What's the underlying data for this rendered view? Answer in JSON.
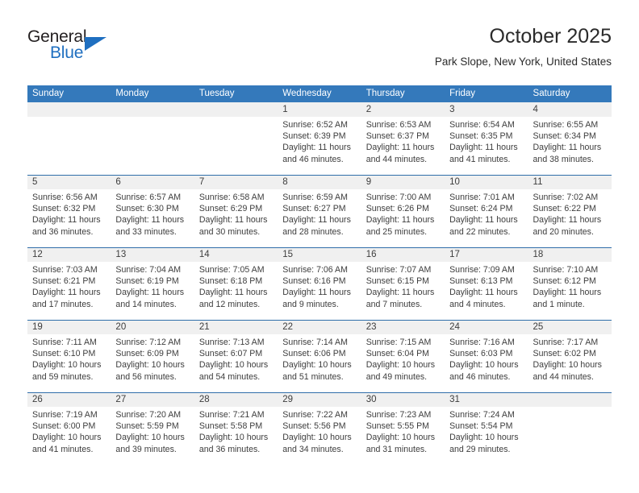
{
  "brand": {
    "word1": "General",
    "word2": "Blue",
    "accent_color": "#1f6fc0"
  },
  "header": {
    "title": "October 2025",
    "subtitle": "Park Slope, New York, United States"
  },
  "theme": {
    "header_bg": "#3479bb",
    "daynum_bg": "#f0f0f0",
    "rule_color": "#2f6ea9",
    "text_color": "#3d3d3d"
  },
  "weekday_headers": [
    "Sunday",
    "Monday",
    "Tuesday",
    "Wednesday",
    "Thursday",
    "Friday",
    "Saturday"
  ],
  "weeks": [
    [
      {
        "day": "",
        "sunrise": "",
        "sunset": "",
        "daylight": "",
        "daylight2": ""
      },
      {
        "day": "",
        "sunrise": "",
        "sunset": "",
        "daylight": "",
        "daylight2": ""
      },
      {
        "day": "",
        "sunrise": "",
        "sunset": "",
        "daylight": "",
        "daylight2": ""
      },
      {
        "day": "1",
        "sunrise": "Sunrise: 6:52 AM",
        "sunset": "Sunset: 6:39 PM",
        "daylight": "Daylight: 11 hours",
        "daylight2": "and 46 minutes."
      },
      {
        "day": "2",
        "sunrise": "Sunrise: 6:53 AM",
        "sunset": "Sunset: 6:37 PM",
        "daylight": "Daylight: 11 hours",
        "daylight2": "and 44 minutes."
      },
      {
        "day": "3",
        "sunrise": "Sunrise: 6:54 AM",
        "sunset": "Sunset: 6:35 PM",
        "daylight": "Daylight: 11 hours",
        "daylight2": "and 41 minutes."
      },
      {
        "day": "4",
        "sunrise": "Sunrise: 6:55 AM",
        "sunset": "Sunset: 6:34 PM",
        "daylight": "Daylight: 11 hours",
        "daylight2": "and 38 minutes."
      }
    ],
    [
      {
        "day": "5",
        "sunrise": "Sunrise: 6:56 AM",
        "sunset": "Sunset: 6:32 PM",
        "daylight": "Daylight: 11 hours",
        "daylight2": "and 36 minutes."
      },
      {
        "day": "6",
        "sunrise": "Sunrise: 6:57 AM",
        "sunset": "Sunset: 6:30 PM",
        "daylight": "Daylight: 11 hours",
        "daylight2": "and 33 minutes."
      },
      {
        "day": "7",
        "sunrise": "Sunrise: 6:58 AM",
        "sunset": "Sunset: 6:29 PM",
        "daylight": "Daylight: 11 hours",
        "daylight2": "and 30 minutes."
      },
      {
        "day": "8",
        "sunrise": "Sunrise: 6:59 AM",
        "sunset": "Sunset: 6:27 PM",
        "daylight": "Daylight: 11 hours",
        "daylight2": "and 28 minutes."
      },
      {
        "day": "9",
        "sunrise": "Sunrise: 7:00 AM",
        "sunset": "Sunset: 6:26 PM",
        "daylight": "Daylight: 11 hours",
        "daylight2": "and 25 minutes."
      },
      {
        "day": "10",
        "sunrise": "Sunrise: 7:01 AM",
        "sunset": "Sunset: 6:24 PM",
        "daylight": "Daylight: 11 hours",
        "daylight2": "and 22 minutes."
      },
      {
        "day": "11",
        "sunrise": "Sunrise: 7:02 AM",
        "sunset": "Sunset: 6:22 PM",
        "daylight": "Daylight: 11 hours",
        "daylight2": "and 20 minutes."
      }
    ],
    [
      {
        "day": "12",
        "sunrise": "Sunrise: 7:03 AM",
        "sunset": "Sunset: 6:21 PM",
        "daylight": "Daylight: 11 hours",
        "daylight2": "and 17 minutes."
      },
      {
        "day": "13",
        "sunrise": "Sunrise: 7:04 AM",
        "sunset": "Sunset: 6:19 PM",
        "daylight": "Daylight: 11 hours",
        "daylight2": "and 14 minutes."
      },
      {
        "day": "14",
        "sunrise": "Sunrise: 7:05 AM",
        "sunset": "Sunset: 6:18 PM",
        "daylight": "Daylight: 11 hours",
        "daylight2": "and 12 minutes."
      },
      {
        "day": "15",
        "sunrise": "Sunrise: 7:06 AM",
        "sunset": "Sunset: 6:16 PM",
        "daylight": "Daylight: 11 hours",
        "daylight2": "and 9 minutes."
      },
      {
        "day": "16",
        "sunrise": "Sunrise: 7:07 AM",
        "sunset": "Sunset: 6:15 PM",
        "daylight": "Daylight: 11 hours",
        "daylight2": "and 7 minutes."
      },
      {
        "day": "17",
        "sunrise": "Sunrise: 7:09 AM",
        "sunset": "Sunset: 6:13 PM",
        "daylight": "Daylight: 11 hours",
        "daylight2": "and 4 minutes."
      },
      {
        "day": "18",
        "sunrise": "Sunrise: 7:10 AM",
        "sunset": "Sunset: 6:12 PM",
        "daylight": "Daylight: 11 hours",
        "daylight2": "and 1 minute."
      }
    ],
    [
      {
        "day": "19",
        "sunrise": "Sunrise: 7:11 AM",
        "sunset": "Sunset: 6:10 PM",
        "daylight": "Daylight: 10 hours",
        "daylight2": "and 59 minutes."
      },
      {
        "day": "20",
        "sunrise": "Sunrise: 7:12 AM",
        "sunset": "Sunset: 6:09 PM",
        "daylight": "Daylight: 10 hours",
        "daylight2": "and 56 minutes."
      },
      {
        "day": "21",
        "sunrise": "Sunrise: 7:13 AM",
        "sunset": "Sunset: 6:07 PM",
        "daylight": "Daylight: 10 hours",
        "daylight2": "and 54 minutes."
      },
      {
        "day": "22",
        "sunrise": "Sunrise: 7:14 AM",
        "sunset": "Sunset: 6:06 PM",
        "daylight": "Daylight: 10 hours",
        "daylight2": "and 51 minutes."
      },
      {
        "day": "23",
        "sunrise": "Sunrise: 7:15 AM",
        "sunset": "Sunset: 6:04 PM",
        "daylight": "Daylight: 10 hours",
        "daylight2": "and 49 minutes."
      },
      {
        "day": "24",
        "sunrise": "Sunrise: 7:16 AM",
        "sunset": "Sunset: 6:03 PM",
        "daylight": "Daylight: 10 hours",
        "daylight2": "and 46 minutes."
      },
      {
        "day": "25",
        "sunrise": "Sunrise: 7:17 AM",
        "sunset": "Sunset: 6:02 PM",
        "daylight": "Daylight: 10 hours",
        "daylight2": "and 44 minutes."
      }
    ],
    [
      {
        "day": "26",
        "sunrise": "Sunrise: 7:19 AM",
        "sunset": "Sunset: 6:00 PM",
        "daylight": "Daylight: 10 hours",
        "daylight2": "and 41 minutes."
      },
      {
        "day": "27",
        "sunrise": "Sunrise: 7:20 AM",
        "sunset": "Sunset: 5:59 PM",
        "daylight": "Daylight: 10 hours",
        "daylight2": "and 39 minutes."
      },
      {
        "day": "28",
        "sunrise": "Sunrise: 7:21 AM",
        "sunset": "Sunset: 5:58 PM",
        "daylight": "Daylight: 10 hours",
        "daylight2": "and 36 minutes."
      },
      {
        "day": "29",
        "sunrise": "Sunrise: 7:22 AM",
        "sunset": "Sunset: 5:56 PM",
        "daylight": "Daylight: 10 hours",
        "daylight2": "and 34 minutes."
      },
      {
        "day": "30",
        "sunrise": "Sunrise: 7:23 AM",
        "sunset": "Sunset: 5:55 PM",
        "daylight": "Daylight: 10 hours",
        "daylight2": "and 31 minutes."
      },
      {
        "day": "31",
        "sunrise": "Sunrise: 7:24 AM",
        "sunset": "Sunset: 5:54 PM",
        "daylight": "Daylight: 10 hours",
        "daylight2": "and 29 minutes."
      },
      {
        "day": "",
        "sunrise": "",
        "sunset": "",
        "daylight": "",
        "daylight2": ""
      }
    ]
  ]
}
